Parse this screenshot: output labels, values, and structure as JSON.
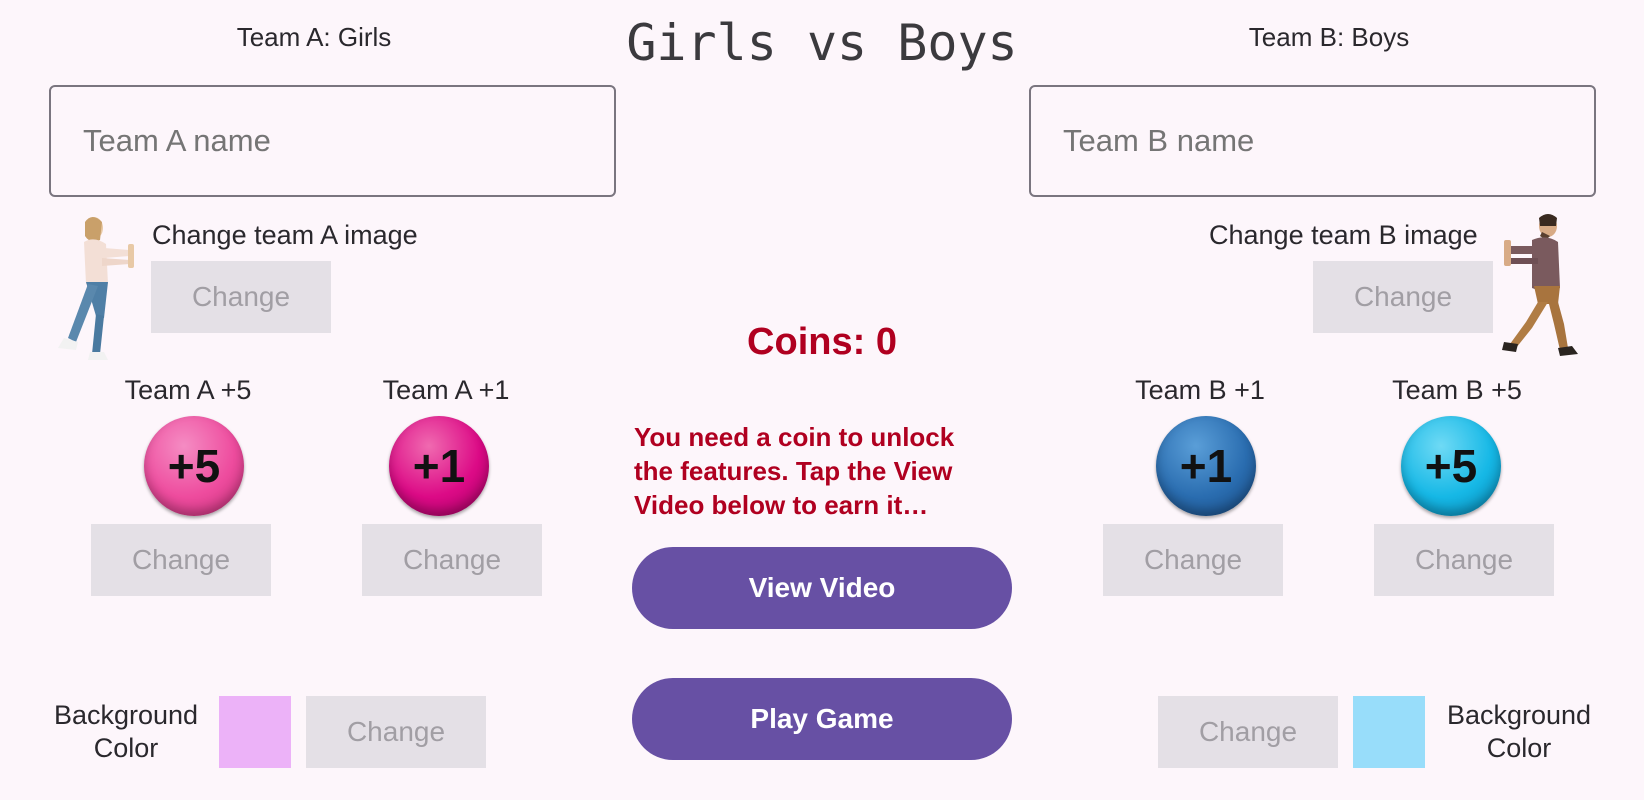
{
  "title": "Girls vs Boys",
  "team_a": {
    "label": "Team A: Girls",
    "name_placeholder": "Team A name",
    "image_label": "Change team A image",
    "image_change": "Change",
    "score5_label": "Team A +5",
    "score5_ball": "+5",
    "score5_change": "Change",
    "score1_label": "Team A +1",
    "score1_ball": "+1",
    "score1_change": "Change",
    "bg_label": "Background Color",
    "bg_change": "Change",
    "bg_color": "#ecb2f8"
  },
  "team_b": {
    "label": "Team B: Boys",
    "name_placeholder": "Team B name",
    "image_label": "Change team B image",
    "image_change": "Change",
    "score1_label": "Team B +1",
    "score1_ball": "+1",
    "score1_change": "Change",
    "score5_label": "Team B +5",
    "score5_ball": "+5",
    "score5_change": "Change",
    "bg_label": "Background Color",
    "bg_change": "Change",
    "bg_color": "#98ddfa"
  },
  "center": {
    "coins": "Coins: 0",
    "notice": "You need a coin to unlock the features. Tap the View Video below to earn it…",
    "view_video": "View Video",
    "play_game": "Play Game"
  },
  "colors": {
    "accent": "#6750a4",
    "alert": "#b00020",
    "disabled_button": "#e4e0e6",
    "background": "#fdf6fb"
  },
  "icons": {
    "team_a_image": "girl-pushing-figure",
    "team_b_image": "boy-pushing-figure"
  }
}
